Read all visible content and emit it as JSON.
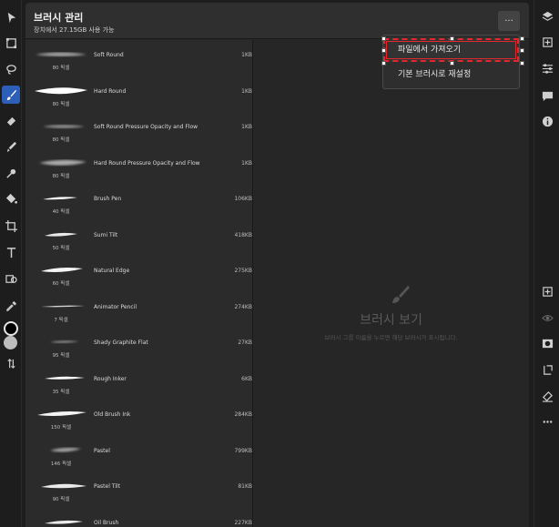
{
  "panel": {
    "title": "브러시 관리",
    "subtitle": "장치에서 27.15GB 사용 가능",
    "more_label": "···"
  },
  "menu": {
    "items": [
      {
        "label": "파일에서 가져오기"
      },
      {
        "label": "기본 브러시로 재설정"
      }
    ]
  },
  "brushes": [
    {
      "name": "Soft Round",
      "px": "80 픽셀",
      "size": "1KB"
    },
    {
      "name": "Hard Round",
      "px": "80 픽셀",
      "size": "1KB"
    },
    {
      "name": "Soft Round Pressure Opacity and Flow",
      "px": "80 픽셀",
      "size": "1KB"
    },
    {
      "name": "Hard Round Pressure Opacity and Flow",
      "px": "80 픽셀",
      "size": "1KB"
    },
    {
      "name": "Brush Pen",
      "px": "40 픽셀",
      "size": "106KB"
    },
    {
      "name": "Sumi Tilt",
      "px": "50 픽셀",
      "size": "418KB"
    },
    {
      "name": "Natural Edge",
      "px": "60 픽셀",
      "size": "275KB"
    },
    {
      "name": "Animator Pencil",
      "px": "7 픽셀",
      "size": "274KB"
    },
    {
      "name": "Shady Graphite Flat",
      "px": "95 픽셀",
      "size": "27KB"
    },
    {
      "name": "Rough Inker",
      "px": "35 픽셀",
      "size": "6KB"
    },
    {
      "name": "Old Brush Ink",
      "px": "150 픽셀",
      "size": "284KB"
    },
    {
      "name": "Pastel",
      "px": "146 픽셀",
      "size": "799KB"
    },
    {
      "name": "Pastel Tilt",
      "px": "90 픽셀",
      "size": "81KB"
    },
    {
      "name": "Oil Brush",
      "px": "",
      "size": "227KB"
    }
  ],
  "empty_state": {
    "title": "브러시 보기",
    "description": "브러시 그룹 이름을 누르면 해당 브러시가 표시됩니다."
  },
  "colors": {
    "accent": "#2d5fb8",
    "highlight": "#e0282e",
    "foreground_swatch": "#000000",
    "background_swatch": "#bdbdbd"
  }
}
